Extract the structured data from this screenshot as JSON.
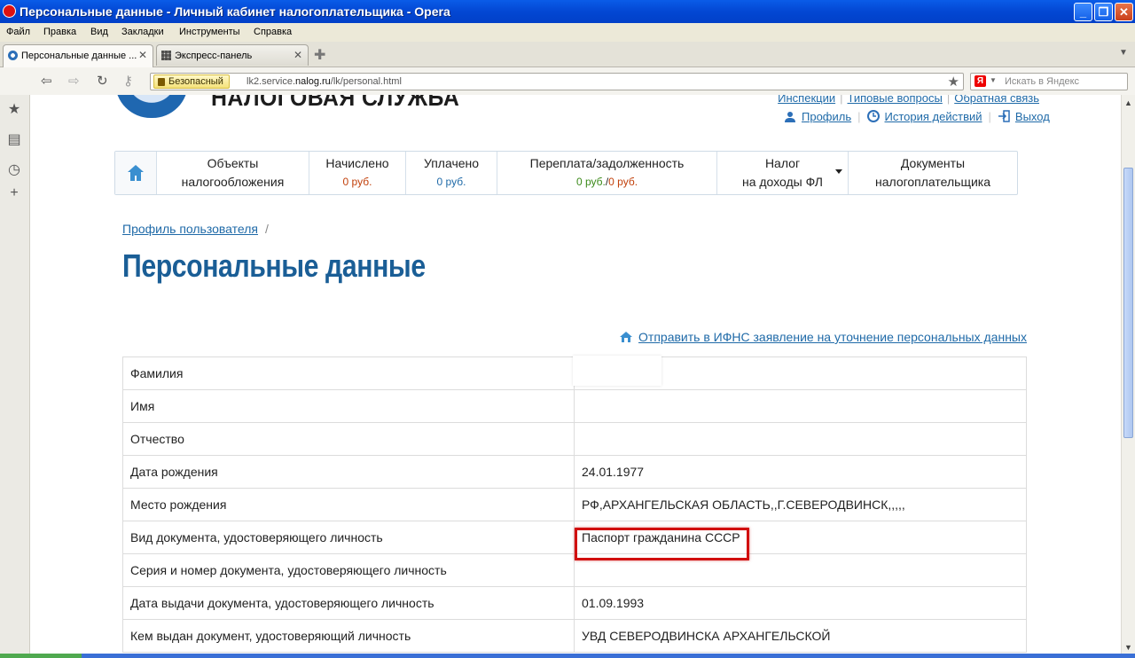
{
  "window": {
    "title": "Персональные данные - Личный кабинет налогоплательщика - Opera"
  },
  "menu": [
    "Файл",
    "Правка",
    "Вид",
    "Закладки",
    "Инструменты",
    "Справка"
  ],
  "tabs": [
    {
      "label": "Персональные данные ..."
    },
    {
      "label": "Экспресс-панель"
    }
  ],
  "address": {
    "secure_label": "Безопасный",
    "url_prefix": "lk2.service.",
    "url_domain": "nalog.ru",
    "url_path": "/lk/personal.html"
  },
  "search": {
    "placeholder": "Искать в Яндекс"
  },
  "site": {
    "brand": "НАЛОГОВАЯ СЛУЖБА",
    "top_links": [
      "Инспекции",
      "Типовые вопросы",
      "Обратная связь"
    ],
    "user_links": {
      "profile": "Профиль",
      "history": "История действий",
      "logout": "Выход"
    }
  },
  "nav": [
    {
      "line1": "Объекты",
      "line2": "налогообложения"
    },
    {
      "line1": "Начислено",
      "amount": "0 руб."
    },
    {
      "line1": "Уплачено",
      "amount": "0 руб."
    },
    {
      "line1": "Переплата/задолженность",
      "amount_over": "0 руб.",
      "amount_sep": "/",
      "amount_debt": "0 руб."
    },
    {
      "line1": "Налог",
      "line2": "на доходы ФЛ"
    },
    {
      "line1": "Документы",
      "line2": "налогоплательщика"
    }
  ],
  "breadcrumb": {
    "link": "Профиль пользователя",
    "sep": "/"
  },
  "page_title": "Персональные данные",
  "send_link": "Отправить в ИФНС заявление на уточнение персональных данных",
  "rows": [
    {
      "label": "Фамилия",
      "value": ""
    },
    {
      "label": "Имя",
      "value": ""
    },
    {
      "label": "Отчество",
      "value": ""
    },
    {
      "label": "Дата рождения",
      "value": "24.01.1977"
    },
    {
      "label": "Место рождения",
      "value": "РФ,АРХАНГЕЛЬСКАЯ ОБЛАСТЬ,,Г.СЕВЕРОДВИНСК,,,,,"
    },
    {
      "label": "Вид документа, удостоверяющего личность",
      "value": "Паспорт гражданина СССР"
    },
    {
      "label": "Серия и номер документа, удостоверяющего личность",
      "value": ""
    },
    {
      "label": "Дата выдачи документа, удостоверяющего личность",
      "value": "01.09.1993"
    },
    {
      "label": "Кем выдан документ, удостоверяющий личность",
      "value": "УВД СЕВЕРОДВИНСКА АРХАНГЕЛЬСКОЙ"
    }
  ]
}
